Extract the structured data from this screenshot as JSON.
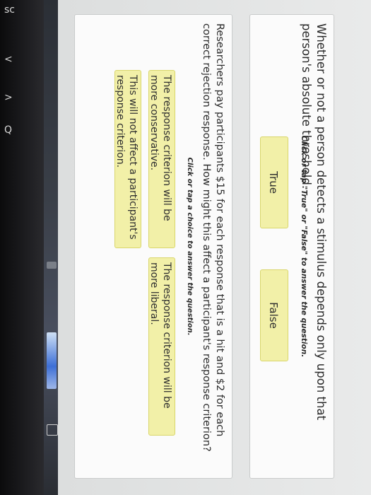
{
  "bezel_keys": [
    "sc",
    "<",
    ">",
    "Q"
  ],
  "taskbar": {
    "icons": [
      "blue-app-thumbnail",
      "chevron-icon",
      "bracket-icon",
      "back-icon",
      "settings-icon"
    ]
  },
  "question1": {
    "text": "Whether or not a person detects a stimulus depends only upon that person's absolute threshold.",
    "instruction": "Click or tap \"True\" or \"False\" to answer the question.",
    "true_label": "True",
    "false_label": "False"
  },
  "question2": {
    "text": "Researchers pay participants $15 for each response that is a hit and $2 for each correct rejection response. How might this affect a participant's response criterion?",
    "instruction": "Click or tap a choice to answer the question.",
    "choices": [
      "The response criterion will be more conservative.",
      "The response criterion will be more liberal.",
      "This will not affect a participant's response criterion."
    ]
  }
}
